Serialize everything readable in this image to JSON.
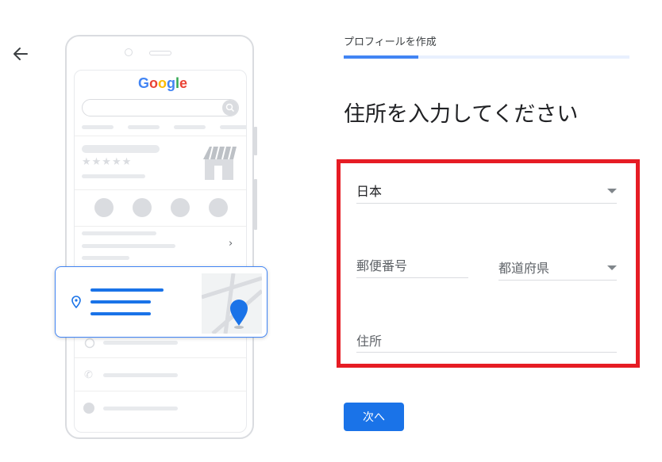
{
  "google_logo": {
    "letters": [
      "G",
      "o",
      "o",
      "g",
      "l",
      "e"
    ],
    "colors": [
      "#4285f4",
      "#ea4335",
      "#fbbc05",
      "#4285f4",
      "#34a853",
      "#ea4335"
    ]
  },
  "stars": "★★★★★",
  "progress": {
    "label": "プロフィールを作成",
    "fraction": 0.26
  },
  "heading": "住所を入力してください",
  "form": {
    "country_value": "日本",
    "postal_placeholder": "郵便番号",
    "prefecture_placeholder": "都道府県",
    "address_placeholder": "住所"
  },
  "next_label": "次へ",
  "colors": {
    "accent": "#1a73e8",
    "highlight": "#e61c24"
  }
}
